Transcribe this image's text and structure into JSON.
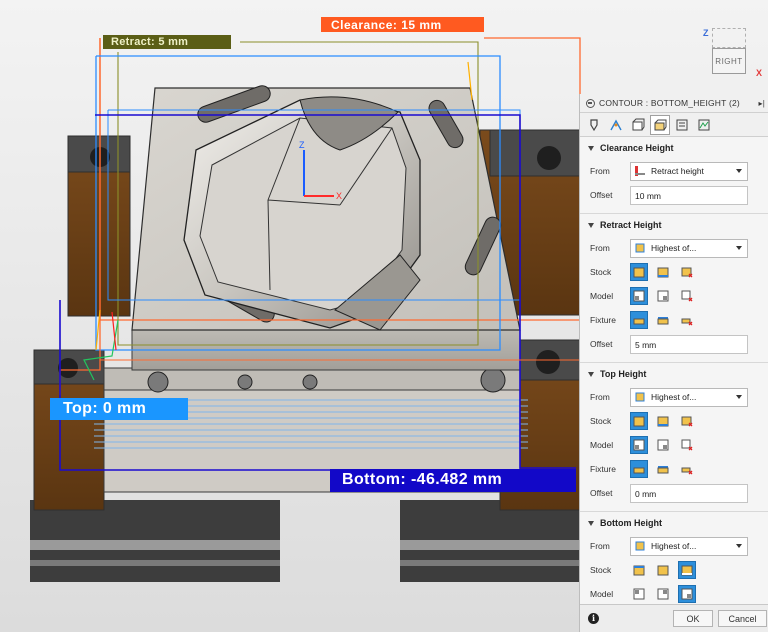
{
  "viewport": {
    "labels": {
      "clearance": "Clearance: 15 mm",
      "retract": "Retract: 5 mm",
      "top": "Top: 0 mm",
      "bottom": "Bottom: -46.482 mm"
    },
    "axes": {
      "z": "Z",
      "x": "X"
    },
    "viewcube": {
      "face": "RIGHT",
      "z": "Z",
      "x": "X"
    },
    "colors": {
      "clearance": "#ff5a20",
      "retract": "#5b5e16",
      "top": "#1a96ff",
      "bottom": "#1208c8"
    }
  },
  "panel": {
    "title": "CONTOUR : BOTTOM_HEIGHT (2)",
    "tabs": [
      "tool-icon",
      "geometry-icon",
      "heights-icon",
      "passes-icon",
      "linking-icon",
      "simulation-icon"
    ],
    "sections": {
      "clearance": {
        "title": "Clearance Height",
        "from_label": "From",
        "from_value": "Retract height",
        "offset_label": "Offset",
        "offset_value": "10 mm"
      },
      "retract": {
        "title": "Retract Height",
        "from_label": "From",
        "from_value": "Highest of...",
        "stock_label": "Stock",
        "model_label": "Model",
        "fixture_label": "Fixture",
        "offset_label": "Offset",
        "offset_value": "5 mm"
      },
      "top": {
        "title": "Top Height",
        "from_label": "From",
        "from_value": "Highest of...",
        "stock_label": "Stock",
        "model_label": "Model",
        "fixture_label": "Fixture",
        "offset_label": "Offset",
        "offset_value": "0 mm"
      },
      "bottom": {
        "title": "Bottom Height",
        "from_label": "From",
        "from_value": "Highest of...",
        "stock_label": "Stock",
        "model_label": "Model"
      }
    },
    "footer": {
      "ok": "OK",
      "cancel": "Cancel",
      "info": "i"
    }
  }
}
